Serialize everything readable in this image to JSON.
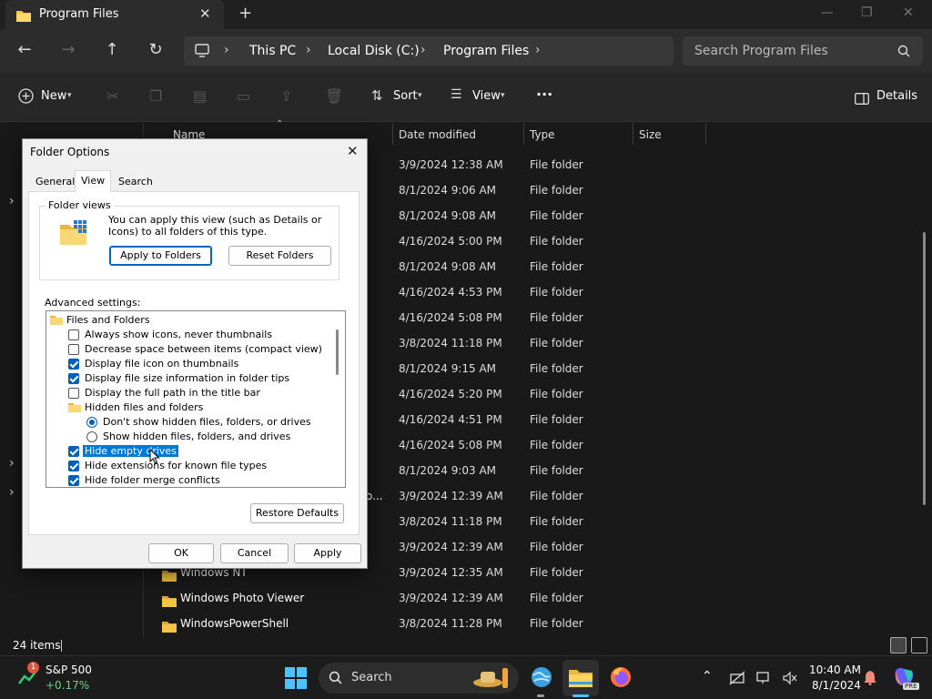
{
  "window": {
    "tab_title": "Program Files",
    "tab_close": "✕",
    "new_tab": "+",
    "min": "—",
    "max": "❐",
    "close": "✕"
  },
  "address": {
    "back": "←",
    "forward": "→",
    "up": "↑",
    "refresh": "↻",
    "crumbs": [
      "This PC",
      "Local Disk (C:)",
      "Program Files"
    ],
    "chevron": "›",
    "search_placeholder": "Search Program Files"
  },
  "commands": {
    "new_label": "New",
    "sort_label": "Sort",
    "view_label": "View",
    "more": "···",
    "details_label": "Details"
  },
  "columns": {
    "name": "Name",
    "date": "Date modified",
    "type": "Type",
    "size": "Size"
  },
  "files": [
    {
      "name": "",
      "date": "3/9/2024 12:38 AM",
      "type": "File folder"
    },
    {
      "name": "",
      "date": "8/1/2024 9:06 AM",
      "type": "File folder"
    },
    {
      "name": "",
      "date": "8/1/2024 9:08 AM",
      "type": "File folder"
    },
    {
      "name": "",
      "date": "4/16/2024 5:00 PM",
      "type": "File folder"
    },
    {
      "name": "",
      "date": "8/1/2024 9:08 AM",
      "type": "File folder"
    },
    {
      "name": "",
      "date": "4/16/2024 4:53 PM",
      "type": "File folder"
    },
    {
      "name": "",
      "date": "4/16/2024 5:08 PM",
      "type": "File folder"
    },
    {
      "name": "",
      "date": "3/8/2024 11:18 PM",
      "type": "File folder"
    },
    {
      "name": "",
      "date": "8/1/2024 9:15 AM",
      "type": "File folder"
    },
    {
      "name": "",
      "date": "4/16/2024 5:20 PM",
      "type": "File folder"
    },
    {
      "name": "",
      "date": "4/16/2024 4:51 PM",
      "type": "File folder"
    },
    {
      "name": "",
      "date": "4/16/2024 5:08 PM",
      "type": "File folder"
    },
    {
      "name": "",
      "date": "8/1/2024 9:03 AM",
      "type": "File folder"
    },
    {
      "name": "o...",
      "date": "3/9/2024 12:39 AM",
      "type": "File folder"
    },
    {
      "name": "",
      "date": "3/8/2024 11:18 PM",
      "type": "File folder"
    },
    {
      "name": "",
      "date": "3/9/2024 12:39 AM",
      "type": "File folder"
    },
    {
      "name": "Windows NT",
      "date": "3/9/2024 12:35 AM",
      "type": "File folder"
    },
    {
      "name": "Windows Photo Viewer",
      "date": "3/9/2024 12:39 AM",
      "type": "File folder"
    },
    {
      "name": "WindowsPowerShell",
      "date": "3/8/2024 11:28 PM",
      "type": "File folder"
    }
  ],
  "status": {
    "item_count": "24 items"
  },
  "dialog": {
    "title": "Folder Options",
    "close": "✕",
    "tabs": [
      "General",
      "View",
      "Search"
    ],
    "folder_views_label": "Folder views",
    "folder_views_text": "You can apply this view (such as Details or Icons) to all folders of this type.",
    "apply_folders": "Apply to Folders",
    "reset_folders": "Reset Folders",
    "advanced_label": "Advanced settings:",
    "tree": [
      {
        "kind": "folder",
        "label": "Files and Folders",
        "indent": 0
      },
      {
        "kind": "check",
        "label": "Always show icons, never thumbnails",
        "checked": false,
        "indent": 1
      },
      {
        "kind": "check",
        "label": "Decrease space between items (compact view)",
        "checked": false,
        "indent": 1
      },
      {
        "kind": "check",
        "label": "Display file icon on thumbnails",
        "checked": true,
        "indent": 1
      },
      {
        "kind": "check",
        "label": "Display file size information in folder tips",
        "checked": true,
        "indent": 1
      },
      {
        "kind": "check",
        "label": "Display the full path in the title bar",
        "checked": false,
        "indent": 1
      },
      {
        "kind": "folder",
        "label": "Hidden files and folders",
        "indent": 1
      },
      {
        "kind": "radio",
        "label": "Don't show hidden files, folders, or drives",
        "checked": true,
        "indent": 2
      },
      {
        "kind": "radio",
        "label": "Show hidden files, folders, and drives",
        "checked": false,
        "indent": 2
      },
      {
        "kind": "check",
        "label": "Hide empty drives",
        "checked": true,
        "indent": 1,
        "selected": true
      },
      {
        "kind": "check",
        "label": "Hide extensions for known file types",
        "checked": true,
        "indent": 1
      },
      {
        "kind": "check",
        "label": "Hide folder merge conflicts",
        "checked": true,
        "indent": 1
      }
    ],
    "restore_defaults": "Restore Defaults",
    "ok": "OK",
    "cancel": "Cancel",
    "apply": "Apply"
  },
  "taskbar": {
    "stock_name": "S&P 500",
    "stock_change": "+0.17%",
    "stock_badge": "1",
    "search_label": "Search",
    "time": "10:40 AM",
    "date": "8/1/2024",
    "tray_chevron": "⌃",
    "copilot_badge": "PRE"
  },
  "colors": {
    "accent": "#0078d7",
    "folder": "#f4c542",
    "dialog_bg": "#f0f0f0",
    "explorer_bg": "#191919"
  }
}
